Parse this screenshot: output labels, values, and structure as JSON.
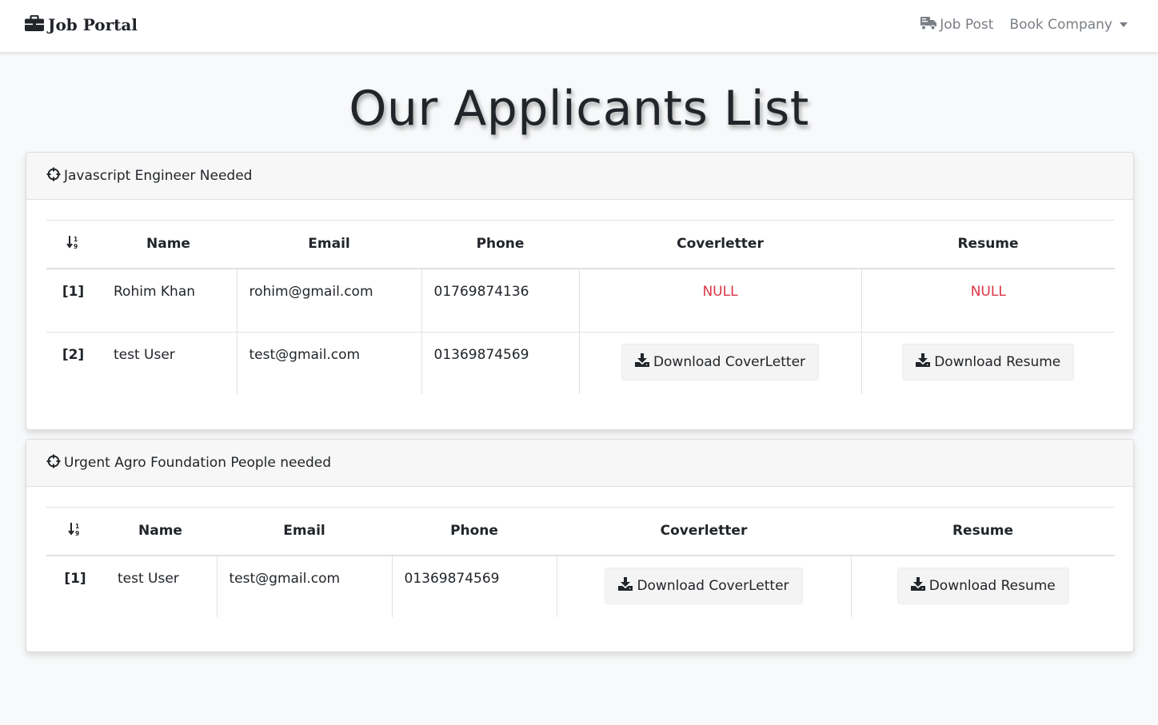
{
  "navbar": {
    "brand": "Job Portal",
    "links": [
      {
        "label": "Job Post",
        "icon": "shipping-icon"
      },
      {
        "label": "Book Company",
        "icon": "caret-down-icon"
      }
    ]
  },
  "page": {
    "title": "Our Applicants List"
  },
  "columns": {
    "sort_icon": "sort-numeric-down-icon",
    "name": "Name",
    "email": "Email",
    "phone": "Phone",
    "coverletter": "Coverletter",
    "resume": "Resume"
  },
  "jobs": [
    {
      "title": "Javascript Engineer Needed",
      "icon": "crosshairs-icon",
      "applicants": [
        {
          "index": "[1]",
          "name": "Rohim Khan",
          "email": "rohim@gmail.com",
          "phone": "01769874136",
          "coverletter": "NULL",
          "resume": "NULL"
        },
        {
          "index": "[2]",
          "name": "test User",
          "email": "test@gmail.com",
          "phone": "01369874569",
          "coverletter": "Download CoverLetter",
          "resume": "Download Resume"
        }
      ]
    },
    {
      "title": "Urgent Agro Foundation People needed",
      "icon": "crosshairs-icon",
      "applicants": [
        {
          "index": "[1]",
          "name": "test User",
          "email": "test@gmail.com",
          "phone": "01369874569",
          "coverletter": "Download CoverLetter",
          "resume": "Download Resume"
        }
      ]
    }
  ],
  "colors": {
    "null_text": "#dc3545",
    "nav_text": "#7a7f85",
    "background": "#f8f9fa"
  }
}
